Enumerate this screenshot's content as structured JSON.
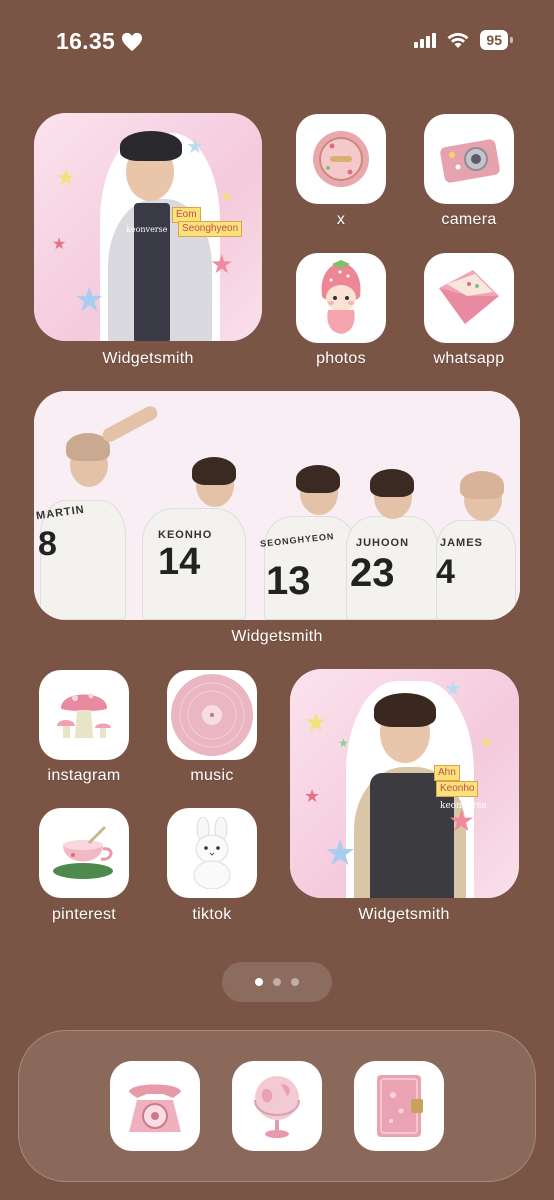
{
  "status": {
    "time": "16.35",
    "battery": "95"
  },
  "grid": {
    "widget1_label": "Widgetsmith",
    "widget1_tag1": "Eom",
    "widget1_tag2": "Seonghyeon",
    "widget1_brand": "keonverse",
    "apps_top": [
      {
        "label": "x",
        "icon": "pink-compact-mirror-icon"
      },
      {
        "label": "camera",
        "icon": "pink-camera-icon"
      },
      {
        "label": "photos",
        "icon": "strawberry-doll-icon"
      },
      {
        "label": "whatsapp",
        "icon": "pink-envelope-icon"
      }
    ],
    "banner_label": "Widgetsmith",
    "banner_jerseys": [
      {
        "name": "MARTIN",
        "number": "8"
      },
      {
        "name": "KEONHO",
        "number": "14"
      },
      {
        "name": "SEONGHYEON",
        "number": "13"
      },
      {
        "name": "JUHOON",
        "number": "23"
      },
      {
        "name": "JAMES",
        "number": "4"
      }
    ],
    "apps_bottom": [
      {
        "label": "instagram",
        "icon": "pink-mushroom-icon"
      },
      {
        "label": "music",
        "icon": "pink-vinyl-icon"
      },
      {
        "label": "pinterest",
        "icon": "teacup-icon"
      },
      {
        "label": "tiktok",
        "icon": "plush-bunny-icon"
      }
    ],
    "widget2_label": "Widgetsmith",
    "widget2_tag1": "Ahn",
    "widget2_tag2": "Keonho",
    "widget2_brand": "keonverse"
  },
  "dock": [
    {
      "icon": "pink-rotary-phone-icon"
    },
    {
      "icon": "pink-globe-icon"
    },
    {
      "icon": "pink-diary-icon"
    }
  ],
  "page_indicator": {
    "count": 3,
    "active": 1
  }
}
